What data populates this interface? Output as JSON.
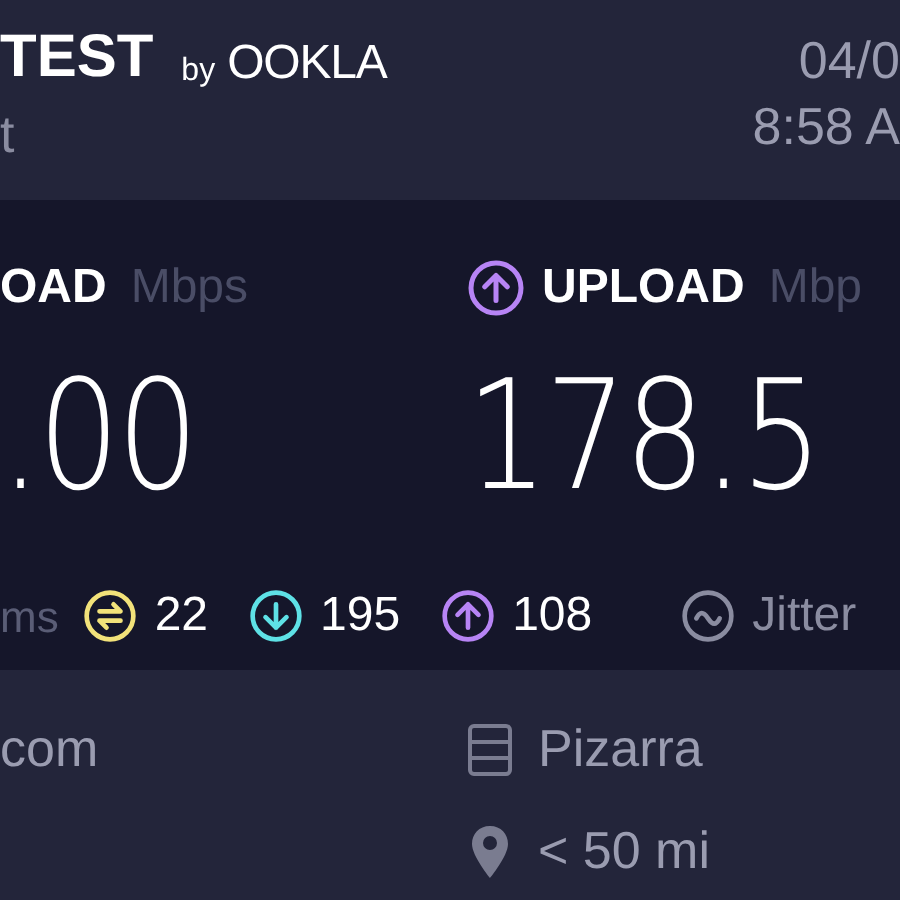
{
  "header": {
    "logo": {
      "word": "TEST",
      "by": "by",
      "brand": "OOKLA"
    },
    "subtitle": "t",
    "date": "04/0",
    "time": "8:58 A"
  },
  "results": [
    {
      "kind": "download",
      "label": "OAD",
      "unit": "Mbps",
      "value": ".00"
    },
    {
      "kind": "upload",
      "label": "UPLOAD",
      "unit": "Mbp",
      "value": "178.5"
    }
  ],
  "ping": {
    "unit": "ms",
    "stats": [
      {
        "kind": "idle",
        "value": "22",
        "color": "#f2e27a"
      },
      {
        "kind": "download",
        "value": "195",
        "color": "#5ee1e6"
      },
      {
        "kind": "upload",
        "value": "108",
        "color": "#b784f5"
      }
    ],
    "jitter": "Jitter"
  },
  "server": {
    "host": "com",
    "name": "Pizarra",
    "distance": "< 50 mi"
  }
}
